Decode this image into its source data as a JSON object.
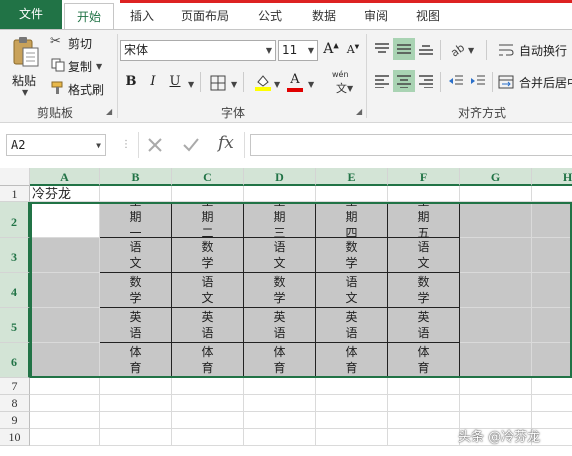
{
  "tabs": {
    "file": "文件",
    "home": "开始",
    "insert": "插入",
    "layout": "页面布局",
    "formulas": "公式",
    "data": "数据",
    "review": "审阅",
    "view": "视图"
  },
  "clipboard": {
    "paste": "粘贴",
    "cut": "剪切",
    "copy": "复制",
    "format_painter": "格式刷",
    "label": "剪贴板"
  },
  "font": {
    "name": "宋体",
    "size": "11",
    "bold": "B",
    "italic": "I",
    "underline": "U",
    "font_color_glyph": "A",
    "phonetic_top": "wén",
    "phonetic_bottom": "文",
    "label": "字体",
    "grow": "A",
    "shrink": "A"
  },
  "alignment": {
    "wrap_text": "自动换行",
    "merge_center": "合并后居中",
    "label": "对齐方式"
  },
  "formula_bar": {
    "name_box": "A2",
    "fx": "fx",
    "value": ""
  },
  "grid": {
    "columns": [
      "A",
      "B",
      "C",
      "D",
      "E",
      "F",
      "G",
      "H"
    ],
    "rows": [
      "1",
      "2",
      "3",
      "4",
      "5",
      "6",
      "7",
      "8",
      "9",
      "10"
    ],
    "a1": "冷芬龙",
    "row2": [
      "星期一",
      "星期二",
      "星期三",
      "星期四",
      "星期五"
    ],
    "row3": [
      "语文",
      "数学",
      "语文",
      "数学",
      "语文"
    ],
    "row4": [
      "数学",
      "语文",
      "数学",
      "语文",
      "数学"
    ],
    "row5": [
      "英语",
      "英语",
      "英语",
      "英语",
      "英语"
    ],
    "row6": [
      "体育",
      "体育",
      "体育",
      "体育",
      "体育"
    ]
  },
  "watermark": "头条 @冷芬龙",
  "colors": {
    "excel_green": "#217346",
    "selection_gray": "#c7c7c7",
    "header_selected": "#d3e4d6"
  }
}
